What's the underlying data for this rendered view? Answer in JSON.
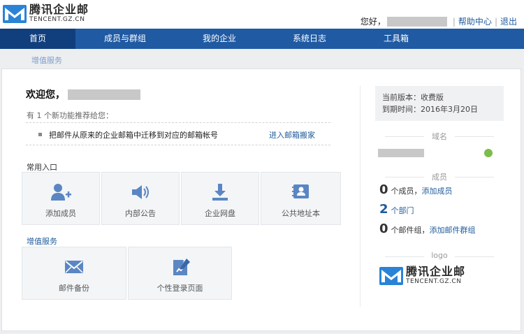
{
  "brand": {
    "name_cn": "腾讯企业邮",
    "name_en": "TENCENT.GZ.CN",
    "accent": "#1f5aa3",
    "nav_active": "#113f7d",
    "link": "#1f5b9c"
  },
  "userbar": {
    "greeting": "您好，",
    "help": "帮助中心",
    "separator": "|",
    "logout": "退出"
  },
  "nav": {
    "items": [
      {
        "label": "首页",
        "active": true
      },
      {
        "label": "成员与群组"
      },
      {
        "label": "我的企业"
      },
      {
        "label": "系统日志"
      },
      {
        "label": "工具箱"
      }
    ],
    "sub": "增值服务"
  },
  "main": {
    "welcome": "欢迎您，",
    "recommend": "有 1 个新功能推荐给您：",
    "rec_item": "把邮件从原来的企业邮箱中迁移到对应的邮箱帐号",
    "rec_link": "进入邮箱搬家",
    "common_label": "常用入口",
    "common": [
      {
        "label": "添加成员",
        "icon": "add-user-icon"
      },
      {
        "label": "内部公告",
        "icon": "speaker-icon"
      },
      {
        "label": "企业网盘",
        "icon": "download-icon"
      },
      {
        "label": "公共地址本",
        "icon": "contact-card-icon"
      }
    ],
    "value_label": "增值服务",
    "value": [
      {
        "label": "邮件备份",
        "icon": "mail-icon"
      },
      {
        "label": "个性登录页面",
        "icon": "edit-page-icon"
      }
    ]
  },
  "side": {
    "version": "当前版本：收费版",
    "expire": "到期时间：2016年3月20日",
    "domain_head": "域名",
    "members_head": "成员",
    "members": {
      "count": "0",
      "unit": "个成员，",
      "link": "添加成员"
    },
    "departments": {
      "count": "2",
      "unit": "个部门"
    },
    "groups": {
      "count": "0",
      "unit": "个邮件组，",
      "link": "添加邮件群组"
    },
    "logo_head": "logo"
  }
}
